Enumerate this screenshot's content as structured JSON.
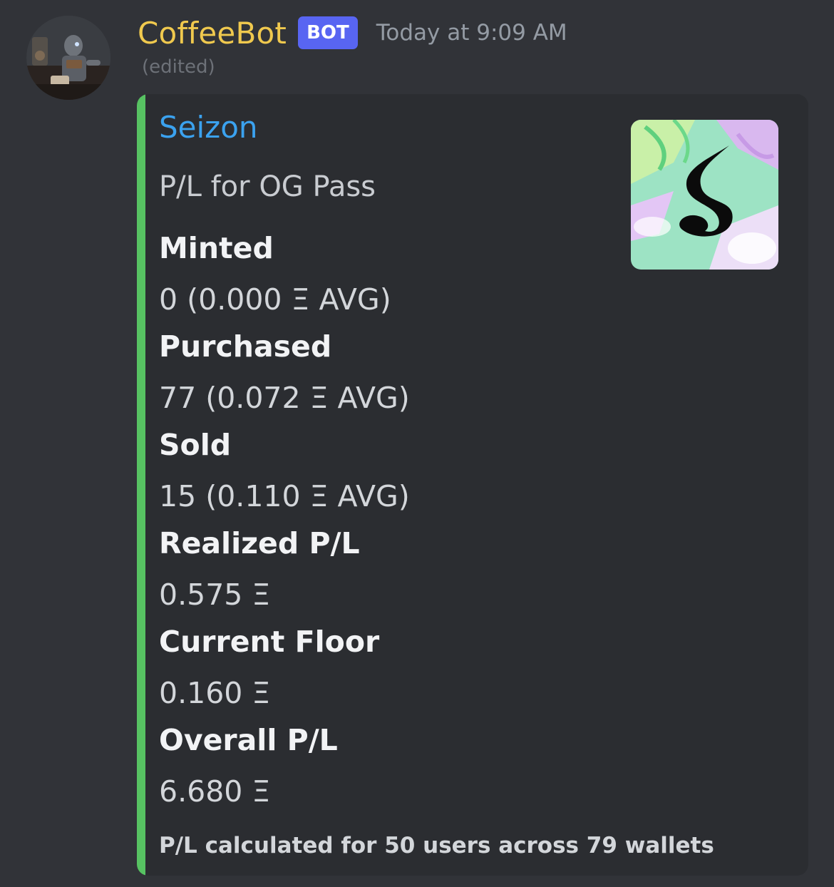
{
  "message": {
    "author": {
      "name": "CoffeeBot",
      "tag": "BOT",
      "name_color": "#f0c94e"
    },
    "timestamp": "Today at 9:09 AM",
    "edited": "(edited)",
    "embed": {
      "accent_color": "#57c262",
      "author": "Seizon",
      "description": "P/L for OG Pass",
      "thumbnail_icon": "seizon-collection-thumbnail",
      "fields": [
        {
          "name": "Minted",
          "value": "0 (0.000 Ξ AVG)"
        },
        {
          "name": "Purchased",
          "value": "77 (0.072 Ξ AVG)"
        },
        {
          "name": "Sold",
          "value": "15 (0.110 Ξ AVG)"
        },
        {
          "name": "Realized P/L",
          "value": "0.575 Ξ"
        },
        {
          "name": "Current Floor",
          "value": "0.160 Ξ"
        },
        {
          "name": "Overall P/L",
          "value": "6.680 Ξ"
        }
      ],
      "footer": "P/L calculated for 50 users across 79 wallets"
    }
  }
}
